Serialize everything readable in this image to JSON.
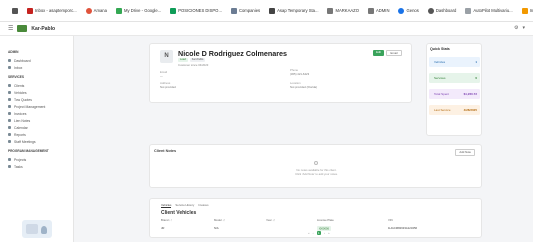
{
  "bookmarks": [
    {
      "label": "",
      "color": "#555555",
      "icon": "grid-icon",
      "round": false
    },
    {
      "label": "Inbox - asaptemporc...",
      "color": "#c5221f",
      "icon": "gmail-icon",
      "round": false
    },
    {
      "label": "Amana",
      "color": "#e0533b",
      "icon": "asana-icon",
      "round": true
    },
    {
      "label": "My Drive - Google...",
      "color": "#34a853",
      "icon": "drive-icon",
      "round": false
    },
    {
      "label": "POSICIONES DISPO...",
      "color": "#0f9d58",
      "icon": "sheets-icon",
      "round": false
    },
    {
      "label": "Companies",
      "color": "#6b7c93",
      "icon": "building-icon",
      "round": false
    },
    {
      "label": "Asap Temporary Sta...",
      "color": "#444444",
      "icon": "web-icon",
      "round": false
    },
    {
      "label": "MARKAAZO",
      "color": "#777777",
      "icon": "folder-icon",
      "round": false
    },
    {
      "label": "ADMIN",
      "color": "#777777",
      "icon": "folder-icon",
      "round": false
    },
    {
      "label": "Genos",
      "color": "#1a73e8",
      "icon": "genos-icon",
      "round": true
    },
    {
      "label": "Dashboard",
      "color": "#555555",
      "icon": "gauge-icon",
      "round": true
    },
    {
      "label": "AutoPilot Multivariu...",
      "color": "#9aa0a6",
      "icon": "autopilot-icon",
      "round": false
    },
    {
      "label": "Inbox",
      "color": "#f29900",
      "icon": "inbox-icon",
      "round": false
    }
  ],
  "app": {
    "brand": "Kar-Pablo"
  },
  "sidebar": {
    "sections": [
      {
        "title": "ADMIN",
        "items": [
          {
            "label": "Dashboard",
            "icon": "dashboard-icon"
          },
          {
            "label": "Inbox",
            "icon": "inbox-icon"
          }
        ]
      },
      {
        "title": "SERVICES",
        "items": [
          {
            "label": "Clients",
            "icon": "users-icon"
          },
          {
            "label": "Vehicles",
            "icon": "car-icon"
          },
          {
            "label": "Tow Quotes",
            "icon": "tow-icon"
          },
          {
            "label": "Project Management",
            "icon": "clipboard-icon"
          },
          {
            "label": "Invoices",
            "icon": "invoice-icon"
          },
          {
            "label": "Lien Notes",
            "icon": "note-icon"
          },
          {
            "label": "Calendar",
            "icon": "calendar-icon"
          },
          {
            "label": "Reports",
            "icon": "report-icon"
          },
          {
            "label": "Staff Meetings",
            "icon": "meeting-icon"
          }
        ]
      },
      {
        "title": "PROGRAM MANAGEMENT",
        "items": [
          {
            "label": "Projects",
            "icon": "folder-icon"
          },
          {
            "label": "Tasks",
            "icon": "tasks-icon"
          }
        ]
      }
    ]
  },
  "profile": {
    "avatar_letter": "N",
    "name": "Nicole D Rodriguez Colmenares",
    "badges": [
      "Lead",
      "Kar-Pablo"
    ],
    "subtitle": "Customer since 04/2023",
    "edit_label": "Edit",
    "email_label": "Email",
    "fields": [
      {
        "label": "Email",
        "value": "—"
      },
      {
        "label": "Phone",
        "value": "(305) 421-6423"
      },
      {
        "label": "Address",
        "value": "Not provided"
      },
      {
        "label": "Location",
        "value": "Not provided (Florida)"
      }
    ]
  },
  "quick_stats": {
    "title": "Quick Stats",
    "rows": [
      {
        "label": "Vehicles",
        "value": "1",
        "bg": "#eaf3fd",
        "fg": "#2a6fb0"
      },
      {
        "label": "Services",
        "value": "0",
        "bg": "#e6f4ea",
        "fg": "#2e7d32"
      },
      {
        "label": "Total Spent",
        "value": "$1,260.72",
        "bg": "#f3eafb",
        "fg": "#7b3fb0"
      },
      {
        "label": "Last Service",
        "value": "4/28/2025",
        "bg": "#fdf1e3",
        "fg": "#b36b10"
      }
    ]
  },
  "notes": {
    "title": "Client Notes",
    "add_label": "Add Note",
    "empty_line1": "No notes available for this client.",
    "empty_line2": "Click 'Add Note' to add your notes."
  },
  "vehicles": {
    "tabs": [
      "Vehicles",
      "Service History",
      "Invoices"
    ],
    "title": "Client Vehicles",
    "columns": [
      "Brand ↓↑",
      "Model ↓↑",
      "Year ↓↑",
      "License Plate",
      "VIN"
    ],
    "rows": [
      {
        "brand": "JR",
        "model": "N/A",
        "year": "",
        "plate": "I000056",
        "vin": "1HGCM82633A123456"
      }
    ],
    "pager": [
      "«",
      "‹",
      "1",
      "›",
      "»"
    ]
  }
}
